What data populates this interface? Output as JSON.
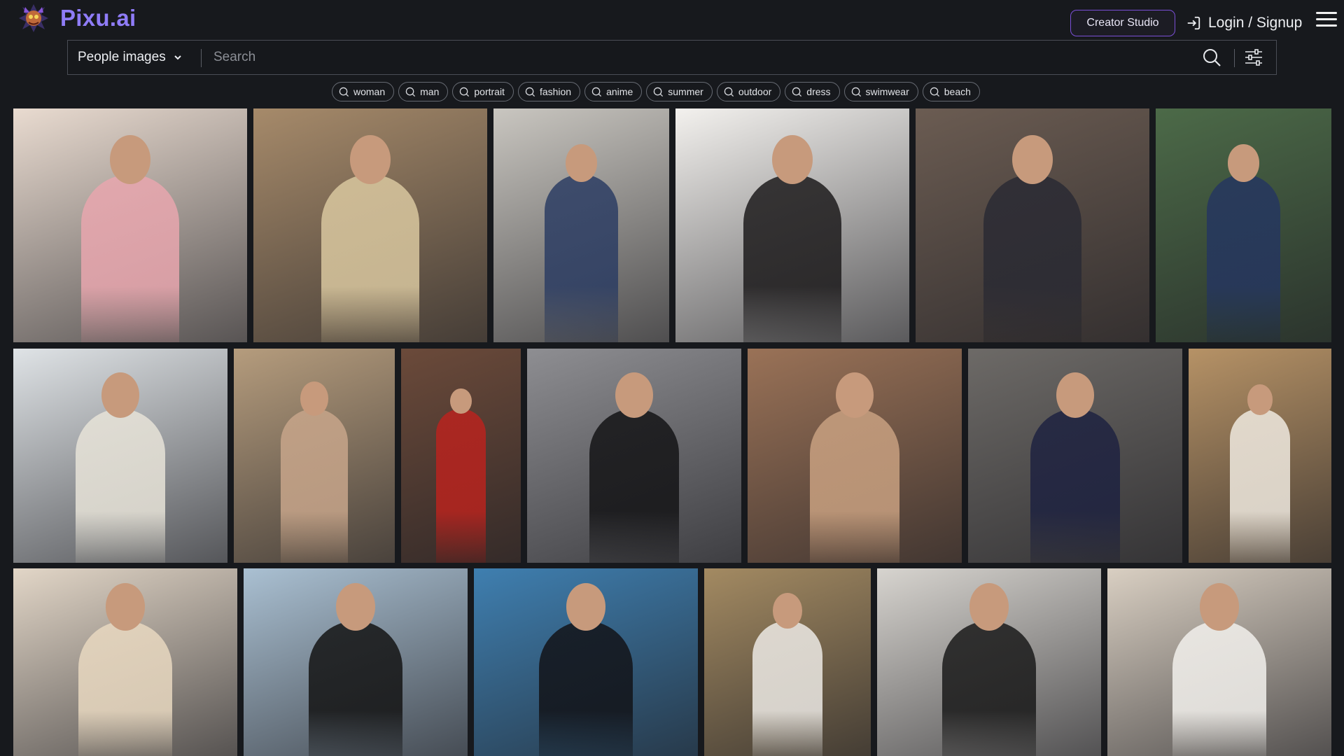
{
  "header": {
    "brand": "Pixu.ai",
    "creator_label": "Creator Studio",
    "login_label": "Login / Signup"
  },
  "search": {
    "category": "People images",
    "placeholder": "Search"
  },
  "tags": [
    "woman",
    "man",
    "portrait",
    "fashion",
    "anime",
    "summer",
    "outdoor",
    "dress",
    "swimwear",
    "beach"
  ],
  "gallery": [
    {
      "name": "woman-pink-lingerie-bed",
      "bg": "#e9dbd0",
      "accent": "#e8a6ae"
    },
    {
      "name": "woman-draped-cream-shawl",
      "bg": "#a68a6a",
      "accent": "#d9c79f"
    },
    {
      "name": "woman-navy-bikini-window",
      "bg": "#c9c6c0",
      "accent": "#2c3d63"
    },
    {
      "name": "woman-black-bodysuit-white-backdrop",
      "bg": "#f3f1ee",
      "accent": "#1d1b1c"
    },
    {
      "name": "woman-floral-dress-brick-alley",
      "bg": "#6b5c52",
      "accent": "#2a2a33"
    },
    {
      "name": "woman-blue-lace-garden",
      "bg": "#4c6a48",
      "accent": "#25365f"
    },
    {
      "name": "woman-knit-cardigan-window",
      "bg": "#dfe3e6",
      "accent": "#e7e3d8"
    },
    {
      "name": "woman-hat-bikini-shadow",
      "bg": "#b59c7d",
      "accent": "#c7a58a"
    },
    {
      "name": "anime-redhead-red-dress",
      "bg": "#6b4a3a",
      "accent": "#b8231e"
    },
    {
      "name": "woman-black-lingerie-studio",
      "bg": "#8e8e92",
      "accent": "#141416"
    },
    {
      "name": "woman-beige-swimsuit-sauna",
      "bg": "#9a7257",
      "accent": "#c8a080"
    },
    {
      "name": "woman-navy-swimsuit-grey-wall",
      "bg": "#6d6a67",
      "accent": "#1e2240"
    },
    {
      "name": "woman-white-halter-dress-sofa",
      "bg": "#b69266",
      "accent": "#efe9df"
    },
    {
      "name": "woman-cream-dress-kitchen",
      "bg": "#e2d6c7",
      "accent": "#e8d8c0"
    },
    {
      "name": "woman-braids-black-swimsuit-beach",
      "bg": "#aac0d2",
      "accent": "#141414"
    },
    {
      "name": "woman-black-hat-dress-mountains",
      "bg": "#3f7fb0",
      "accent": "#121318"
    },
    {
      "name": "woman-white-bodysuit-field",
      "bg": "#a38a62",
      "accent": "#ece9e4"
    },
    {
      "name": "woman-mirror-selfie-black-top",
      "bg": "#d7d4cf",
      "accent": "#1a1a1a"
    },
    {
      "name": "woman-white-tank-window",
      "bg": "#d9cfc2",
      "accent": "#f2f0ec"
    }
  ]
}
